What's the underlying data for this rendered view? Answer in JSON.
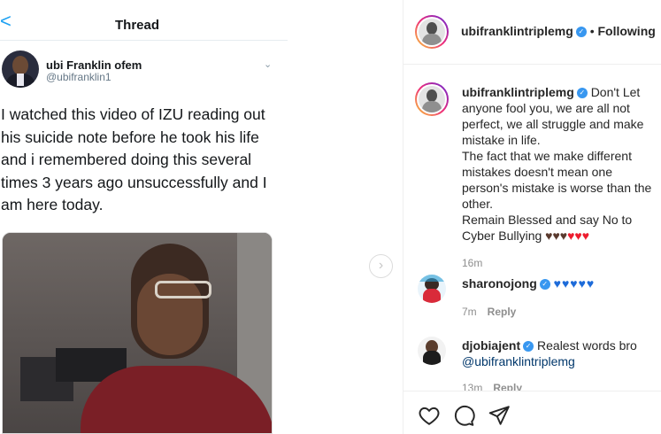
{
  "tweet": {
    "header_title": "Thread",
    "back_glyph": "<",
    "author_name": "ubi Franklin ofem",
    "author_handle": "@ubifranklin1",
    "text": "I watched this video of IZU reading out his suicide note before he took his life and i remembered doing this several times 3 years ago unsuccessfully and I am here today."
  },
  "post": {
    "username": "ubifranklintriplemg",
    "separator": "•",
    "follow_label": "Following",
    "caption": {
      "username": "ubifranklintriplemg",
      "text_1": "Don't Let anyone fool you, we are all not perfect, we all struggle and make mistake in life.",
      "text_2": "The fact that we make different mistakes doesn't mean one person's mistake is worse than the other.",
      "text_3": "Remain Blessed and say No to Cyber Bullying",
      "time": "16m"
    },
    "comments": [
      {
        "username": "sharonojong",
        "text": "",
        "time": "7m",
        "reply_label": "Reply"
      },
      {
        "username": "djobiajent",
        "text": "Realest words bro",
        "mention": "@ubifranklintriplemg",
        "time": "13m",
        "reply_label": "Reply"
      }
    ]
  },
  "icons": {
    "verified": "verified-badge-icon",
    "heart": "heart-icon",
    "comment": "comment-icon",
    "share": "paper-plane-icon",
    "next": "chevron-right-icon"
  },
  "colors": {
    "twitter_blue": "#1da1f2",
    "verified_blue": "#3897f0",
    "heart_red": "#ed1c2e",
    "heart_brown": "#5a3a2e",
    "heart_blue": "#1d6bd9"
  }
}
